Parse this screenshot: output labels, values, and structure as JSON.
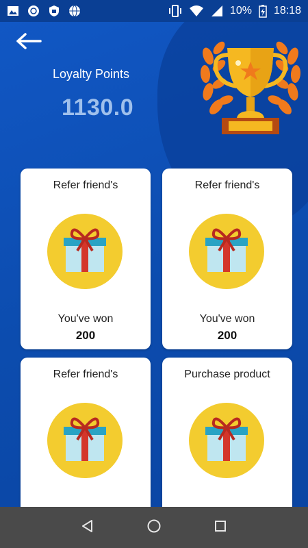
{
  "status": {
    "battery": "10%",
    "time": "18:18",
    "icons": [
      "image-icon",
      "sync-icon",
      "shield-icon",
      "globe-icon",
      "vibrate-icon",
      "wifi-icon",
      "signal-icon",
      "battery-charging-icon"
    ]
  },
  "header": {
    "back_icon": "arrow-left-icon",
    "loyalty_label": "Loyalty Points",
    "loyalty_value": "1130.0",
    "trophy_icon": "trophy-icon"
  },
  "cards": [
    {
      "title": "Refer friend's",
      "subtitle": "You've won",
      "points": "200",
      "icon": "gift-icon"
    },
    {
      "title": "Refer friend's",
      "subtitle": "You've won",
      "points": "200",
      "icon": "gift-icon"
    },
    {
      "title": "Refer friend's",
      "subtitle": "",
      "points": "",
      "icon": "gift-icon"
    },
    {
      "title": "Purchase product",
      "subtitle": "",
      "points": "",
      "icon": "gift-icon"
    }
  ],
  "nav": {
    "icons": [
      "back-triangle-icon",
      "home-circle-icon",
      "recents-square-icon"
    ]
  },
  "colors": {
    "background": "#0d4fb0",
    "gift_circle": "#f3cc2f",
    "value_text": "#9fc0ec",
    "trophy_gold": "#f5b821",
    "laurel": "#f07a1c"
  }
}
